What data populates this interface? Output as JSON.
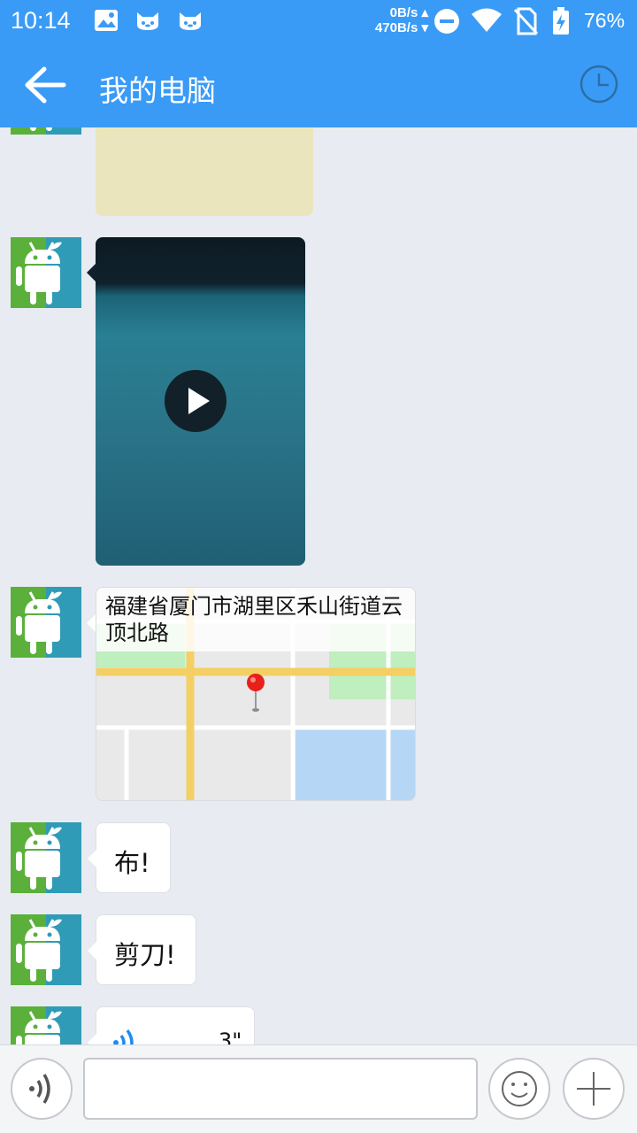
{
  "status_bar": {
    "time": "10:14",
    "net_up": "0B/s",
    "net_down": "470B/s",
    "battery": "76%",
    "icons": [
      "image-icon",
      "cat-icon",
      "cat-icon",
      "dnd-icon",
      "wifi-icon",
      "no-sim-icon",
      "battery-charging-icon"
    ]
  },
  "header": {
    "title": "我的电脑",
    "back_icon": "arrow-left-icon",
    "history_icon": "clock-icon"
  },
  "messages": [
    {
      "type": "card",
      "id": "prev-card"
    },
    {
      "type": "video",
      "icon": "play-icon"
    },
    {
      "type": "location",
      "text": "福建省厦门市湖里区禾山街道云顶北路"
    },
    {
      "type": "text",
      "text": "布!"
    },
    {
      "type": "text",
      "text": "剪刀!"
    },
    {
      "type": "voice",
      "duration": "3\"",
      "icon": "voice-wave-icon"
    }
  ],
  "input_bar": {
    "value": "",
    "placeholder": "",
    "voice_icon": "voice-icon",
    "emoji_icon": "smile-icon",
    "plus_icon": "plus-icon"
  },
  "colors": {
    "accent": "#3a9bf6",
    "chat_bg": "#e8ebf1",
    "avatar_green": "#5ab03a",
    "avatar_teal": "#2f9bb6"
  }
}
